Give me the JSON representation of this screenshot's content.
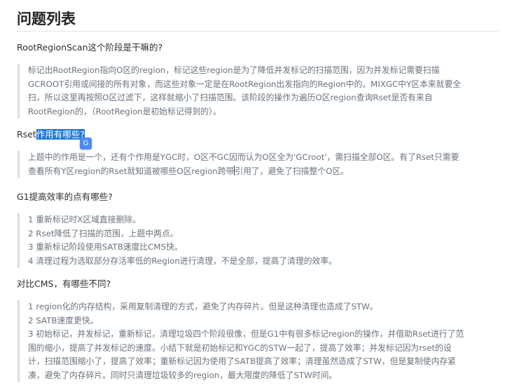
{
  "title": "问题列表",
  "sections": [
    {
      "question": "RootRegionScan这个阶段是干嘛的?",
      "answer_lines": [
        "标记出RootRegion指向O区的region，标记这些region是为了降低并发标记的扫描范围，因为并发标记需要扫描",
        "GCROOT引用或间接的所有对象，而这些对象一定是在RootRegion出发指向的Region中的。MIXGC中Y区本来就要全",
        "扫，所以这里再按照O区过滤下，这样就缩小了扫描范围。该阶段的操作为遍历O区region查询Rset是否有来自",
        "RootRegion的，（RootRegion是初始标记得到的）。"
      ]
    },
    {
      "question_prefix": "Rset",
      "question_highlight": "作用有哪些?",
      "answer_lines_1a": "上题中的作用是一个，还有个作用是YGC时，O区不GC因而认为O区全为'GCroot'，需扫描全部O区。有了Rset只需要",
      "answer_lines_2a": "查看所有Y区region的Rset就知道被哪些O区region跨带",
      "answer_lines_2b": "引用了，避免了扫描整个O区。"
    },
    {
      "question": "G1提高效率的点有哪些?",
      "answer_lines": [
        "1 重新标记时X区域直接删除。",
        "2 Rset降低了扫描的范围，上题中两点。",
        "3 重新标记阶段使用SATB速度比CMS快。",
        "4 清理过程为选取部分存活率低的Region进行清理，不是全部，提高了清理的效率。"
      ]
    },
    {
      "question": "对比CMS，有哪些不同?",
      "answer_lines": [
        "1 region化的内存结构，采用复制清理的方式，避免了内存碎片。但是这种清理也造成了STW。",
        "2 SATB速度更快。",
        "3 初始标记，并发标记，重新标记，清理垃圾四个阶段很像，但是G1中有很多标记region的操作，并借助Rset进行了范",
        "围的缩小，提高了并发标记的速度。小结下就是初始标记和YGC的STW一起了，提高了效率；并发标记因为rset的设",
        "计，扫描范围缩小了，提高了效率；重新标记因为使用了SATB提高了效率；清理虽然造成了STW，但是复制使内存紧",
        "凑，避免了内存碎片。同时只清理垃圾较多的region，最大限度的降低了STW时间。"
      ]
    }
  ],
  "translate_icon_glyph": "G",
  "colors": {
    "highlight_bg": "#1e78d6",
    "quote_border": "#dcdcdc",
    "quote_text": "#6a737d",
    "translate_icon_bg": "#4a8af4"
  }
}
